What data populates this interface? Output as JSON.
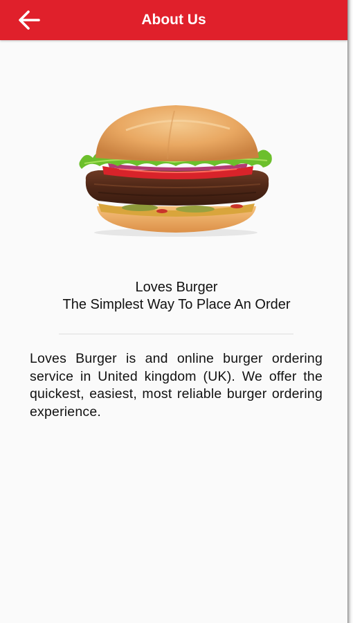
{
  "header": {
    "title": "About Us",
    "back_icon": "arrow-left-icon",
    "background_color": "#e0202b"
  },
  "brand": {
    "image": "burger-image",
    "name": "Loves Burger",
    "tagline": "The Simplest Way To Place An Order"
  },
  "about": {
    "text": "Loves Burger is and online burger ordering service in United kingdom (UK). We offer the quickest, easiest, most reliable burger ordering experience."
  }
}
